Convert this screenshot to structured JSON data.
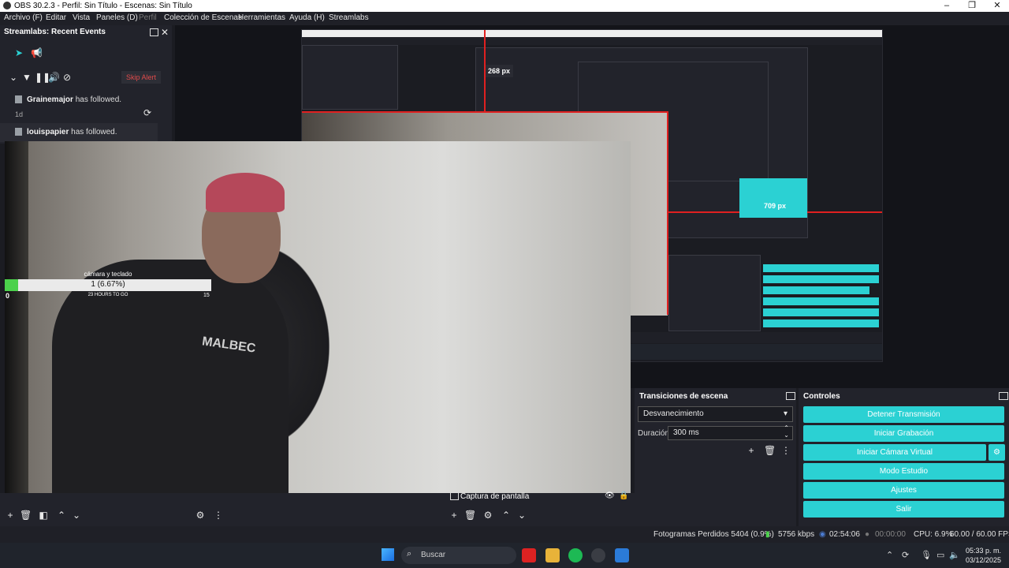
{
  "window": {
    "title": "OBS 30.2.3 - Perfil: Sin Título - Escenas: Sin Título"
  },
  "menu": [
    {
      "label": "Archivo (F)",
      "enabled": true
    },
    {
      "label": "Editar",
      "enabled": true
    },
    {
      "label": "Vista",
      "enabled": true
    },
    {
      "label": "Paneles (D)",
      "enabled": true
    },
    {
      "label": "Perfil",
      "enabled": false
    },
    {
      "label": "Colección de Escenas",
      "enabled": true
    },
    {
      "label": "Herramientas",
      "enabled": true
    },
    {
      "label": "Ayuda (H)",
      "enabled": true
    },
    {
      "label": "Streamlabs",
      "enabled": true
    }
  ],
  "dock": {
    "title": "Streamlabs: Recent Events",
    "skip_alert": "Skip Alert",
    "events": [
      {
        "user": "Grainemajor",
        "action": "has followed.",
        "ago": "1d"
      },
      {
        "user": "louispapier",
        "action": "has followed.",
        "ago": ""
      }
    ]
  },
  "nested_preview": {
    "label_268": "268 px",
    "label_709": "709 px"
  },
  "progress_widget": {
    "title": "cámara y teclado",
    "value_text": "1 (6.67%)",
    "fraction": 0.0667,
    "min": "0",
    "max": "15",
    "footer": "23 HOURS TO GO"
  },
  "camera": {
    "shirt_text": "MALBEC"
  },
  "sources": {
    "selected_source": "Captura de pantalla"
  },
  "transitions": {
    "title": "Transiciones de escena",
    "selected": "Desvanecimiento",
    "duration_label": "Duración",
    "duration_value": "300 ms"
  },
  "controls": {
    "title": "Controles",
    "buttons": [
      "Detener Transmisión",
      "Iniciar Grabación",
      "Iniciar Cámara Virtual",
      "Modo Estudio",
      "Ajustes",
      "Salir"
    ]
  },
  "status": {
    "dropped_frames": "Fotogramas Perdidos 5404 (0.9%)",
    "bitrate": "5756 kbps",
    "stream_time": "02:54:06",
    "rec_time": "00:00:00",
    "cpu": "CPU: 6.9%",
    "fps": "60.00 / 60.00 FPS"
  },
  "taskbar": {
    "search_placeholder": "Buscar",
    "time": "05:33 p. m.",
    "date": "03/12/2025"
  },
  "colors": {
    "accent": "#2bd1d3",
    "panel": "#22232b",
    "alert_red": "#e04b4b",
    "progress_green": "#4bd14b"
  }
}
